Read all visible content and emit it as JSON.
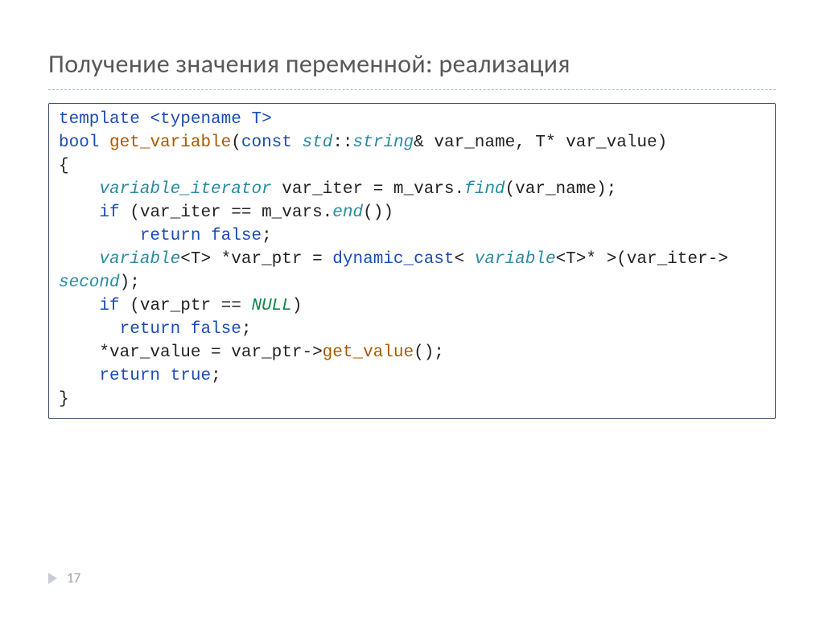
{
  "title": "Получение значения переменной: реализация",
  "page_number": "17",
  "code": {
    "l1": {
      "t1": "template",
      "t2": "<",
      "t3": "typename",
      "t4": " T>"
    },
    "l2": {
      "t1": "bool",
      "t2": "get_variable",
      "t3": "(",
      "t4": "const",
      "t5": "std",
      "t6": "::",
      "t7": "string",
      "t8": "& var_name, T* var_value)"
    },
    "l3": "{",
    "l4": {
      "indent": "    ",
      "t1": "variable_iterator",
      "t2": " var_iter = m_vars.",
      "t3": "find",
      "t4": "(var_name);"
    },
    "l5": {
      "indent": "    ",
      "t1": "if",
      "t2": " (var_iter == m_vars.",
      "t3": "end",
      "t4": "())"
    },
    "l6": {
      "indent": "        ",
      "t1": "return",
      "t2": "false",
      "t3": ";"
    },
    "l7a": {
      "indent": "    ",
      "t1": "variable",
      "t2": "<T> *var_ptr = ",
      "t3": "dynamic_cast",
      "t4": "< ",
      "t5": "variable",
      "t6": "<T>* >(var_iter->"
    },
    "l7b": {
      "t1": "second",
      "t2": ");"
    },
    "l8": {
      "indent": "    ",
      "t1": "if",
      "t2": " (var_ptr == ",
      "t3": "NULL",
      "t4": ")"
    },
    "l9": {
      "indent": "      ",
      "t1": "return",
      "t2": "false",
      "t3": ";"
    },
    "l10": {
      "indent": "    ",
      "t1": "*var_value = var_ptr->",
      "t2": "get_value",
      "t3": "();"
    },
    "l11": {
      "indent": "    ",
      "t1": "return",
      "t2": "true",
      "t3": ";"
    },
    "l12": "}"
  }
}
